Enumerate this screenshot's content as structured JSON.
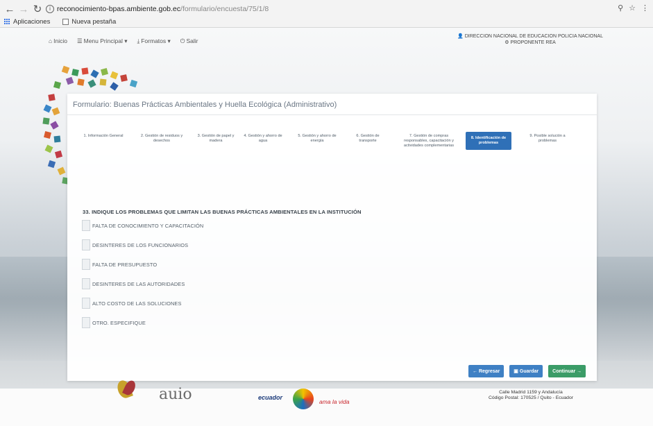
{
  "browser": {
    "url_host": "reconocimiento-bpas.ambiente.gob.ec",
    "url_path": "/formulario/encuesta/75/1/8",
    "bookmarks": [
      {
        "label": "Aplicaciones"
      },
      {
        "label": "Nueva pestaña"
      }
    ]
  },
  "topnav": {
    "items": [
      {
        "label": "Inicio"
      },
      {
        "label": "Menu Principal ▾"
      },
      {
        "label": "Formatos ▾"
      },
      {
        "label": "Salir"
      }
    ],
    "user_line1": "DIRECCION NACIONAL DE EDUCACION POLICIA NACIONAL",
    "user_line2": "PROPONENTE REA"
  },
  "form": {
    "title": "Formulario: Buenas Prácticas Ambientales y Huella Ecológica (Administrativo)",
    "steps": [
      {
        "label": "1. Información General"
      },
      {
        "label": "2. Gestión de residuos y desechos"
      },
      {
        "label": "3. Gestión de papel y madera"
      },
      {
        "label": "4. Gestión y ahorro de agua"
      },
      {
        "label": "5. Gestión y ahorro de energía"
      },
      {
        "label": "6. Gestión de transporte"
      },
      {
        "label": "7. Gestión de compras responsables, capacitación y actividades complementarias"
      },
      {
        "label": "8. Identificación de problemas"
      },
      {
        "label": "9. Posible solución a problemas"
      }
    ],
    "active_step": 8,
    "question": "33. INDIQUE LOS PROBLEMAS QUE LIMITAN LAS BUENAS PRÁCTICAS AMBIENTALES EN LA INSTITUCIÓN",
    "options": [
      {
        "label": "FALTA DE CONOCIMIENTO Y CAPACITACIÓN",
        "checked": false
      },
      {
        "label": "DESINTERES DE LOS FUNCIONARIOS",
        "checked": false
      },
      {
        "label": "FALTA DE PRESUPUESTO",
        "checked": false
      },
      {
        "label": "DESINTERES DE LAS AUTORIDADES",
        "checked": false
      },
      {
        "label": "ALTO COSTO DE LAS SOLUCIONES",
        "checked": false
      },
      {
        "label": "OTRO. ESPECIFIQUE",
        "checked": false
      }
    ],
    "buttons": {
      "back": "← Regresar",
      "save": "Guardar",
      "next": "Continuar →"
    }
  },
  "footer": {
    "brand_text": "auio",
    "gov_logo_text": "ecuador",
    "slogan": "ama la vida",
    "address_line1": "Calle Madrid 1159 y Andalucía",
    "address_line2": "Código Postal: 170525 / Quito - Ecuador"
  }
}
